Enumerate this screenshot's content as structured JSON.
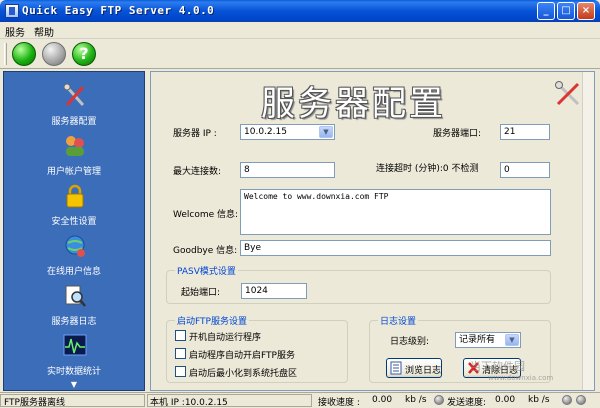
{
  "window": {
    "title": "Quick Easy FTP Server 4.0.0",
    "min_label": "_",
    "max_label": "□",
    "close_label": "×"
  },
  "menu": {
    "items": [
      "服务",
      "帮助"
    ]
  },
  "toolbar": {
    "help_label": "?"
  },
  "sidebar": {
    "items": [
      {
        "label": "服务器配置",
        "icon": "tools-icon"
      },
      {
        "label": "用户帐户管理",
        "icon": "users-icon"
      },
      {
        "label": "安全性设置",
        "icon": "lock-icon"
      },
      {
        "label": "在线用户信息",
        "icon": "globe-users-icon"
      },
      {
        "label": "服务器日志",
        "icon": "log-search-icon"
      },
      {
        "label": "实时数据统计",
        "icon": "stats-icon"
      }
    ],
    "scroll_arrow": "▼"
  },
  "main": {
    "title": "服务器配置",
    "server_ip_label": "服务器 IP :",
    "server_ip_value": "10.0.2.15",
    "server_port_label": "服务器端口:",
    "server_port_value": "21",
    "max_conn_label": "最大连接数:",
    "max_conn_value": "8",
    "timeout_label": "连接超时 (分钟):0 不检测",
    "timeout_value": "0",
    "welcome_label": "Welcome 信息:",
    "welcome_value": "Welcome to www.downxia.com FTP",
    "goodbye_label": "Goodbye 信息:",
    "goodbye_value": "Bye",
    "pasv_group": "PASV模式设置",
    "start_port_label": "起始端口:",
    "start_port_value": "1024",
    "startup_group": "启动FTP服务设置",
    "startup_options": [
      "开机自动运行程序",
      "启动程序自动开启FTP服务",
      "启动后最小化到系统托盘区"
    ],
    "log_group": "日志设置",
    "log_level_label": "日志级别:",
    "log_level_value": "记录所有",
    "browse_log_button": "浏览日志",
    "clear_log_button": "清除日志"
  },
  "statusbar": {
    "server_status": "FTP服务器离线",
    "local_ip": "本机 IP :10.0.2.15",
    "recv_label": "接收速度 :",
    "recv_value": "0.00",
    "recv_unit": "kb /s",
    "send_label": "发送速度:",
    "send_value": "0.00",
    "send_unit": "kb /s"
  },
  "watermark": {
    "line1": "当下软件园",
    "line2": "www.downxia.com"
  },
  "colors": {
    "accent": "#0046d5",
    "sidebar": "#3c6db8",
    "titlebar": "#0653d6"
  }
}
